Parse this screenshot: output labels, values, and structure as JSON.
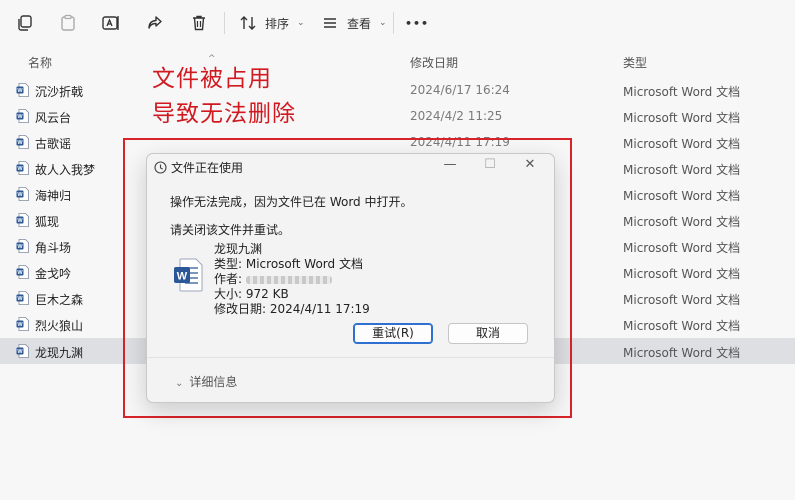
{
  "toolbar": {
    "sort_label": "排序",
    "view_label": "查看",
    "more_label": "•••"
  },
  "columns": {
    "name": "名称",
    "modified": "修改日期",
    "type": "类型"
  },
  "files": [
    {
      "name": "沉沙折戟",
      "date": "2024/6/17 16:24",
      "type": "Microsoft Word 文档"
    },
    {
      "name": "风云台",
      "date": "2024/4/2 11:25",
      "type": "Microsoft Word 文档"
    },
    {
      "name": "古歌谣",
      "date": "2024/4/11 17:19",
      "type": "Microsoft Word 文档"
    },
    {
      "name": "故人入我梦",
      "date": "",
      "type": "Microsoft Word 文档"
    },
    {
      "name": "海神归",
      "date": "",
      "type": "Microsoft Word 文档"
    },
    {
      "name": "狐现",
      "date": "",
      "type": "Microsoft Word 文档"
    },
    {
      "name": "角斗场",
      "date": "",
      "type": "Microsoft Word 文档"
    },
    {
      "name": "金戈吟",
      "date": "",
      "type": "Microsoft Word 文档"
    },
    {
      "name": "巨木之森",
      "date": "",
      "type": "Microsoft Word 文档"
    },
    {
      "name": "烈火狼山",
      "date": "",
      "type": "Microsoft Word 文档"
    },
    {
      "name": "龙现九渊",
      "date": "",
      "type": "Microsoft Word 文档"
    }
  ],
  "annotation": {
    "line1": "文件被占用",
    "line2": "导致无法删除"
  },
  "dialog": {
    "title": "文件正在使用",
    "message": "操作无法完成，因为文件已在 Word 中打开。",
    "instruction": "请关闭该文件并重试。",
    "file_name": "龙现九渊",
    "file_type": "类型: Microsoft Word 文档",
    "author_label": "作者:",
    "size": "大小: 972 KB",
    "modified": "修改日期: 2024/4/11 17:19",
    "retry_label": "重试(R)",
    "cancel_label": "取消",
    "details_label": "详细信息",
    "minimize": "—",
    "maximize": "☐",
    "close": "✕"
  },
  "colors": {
    "accent": "#2f6fcf",
    "annotation_red": "#d01a20",
    "word_blue": "#2b5797"
  },
  "icons": [
    "copy-icon",
    "paste-icon",
    "rename-icon",
    "share-icon",
    "delete-icon",
    "sort-icon",
    "view-icon",
    "word-doc-icon",
    "clock-icon"
  ]
}
